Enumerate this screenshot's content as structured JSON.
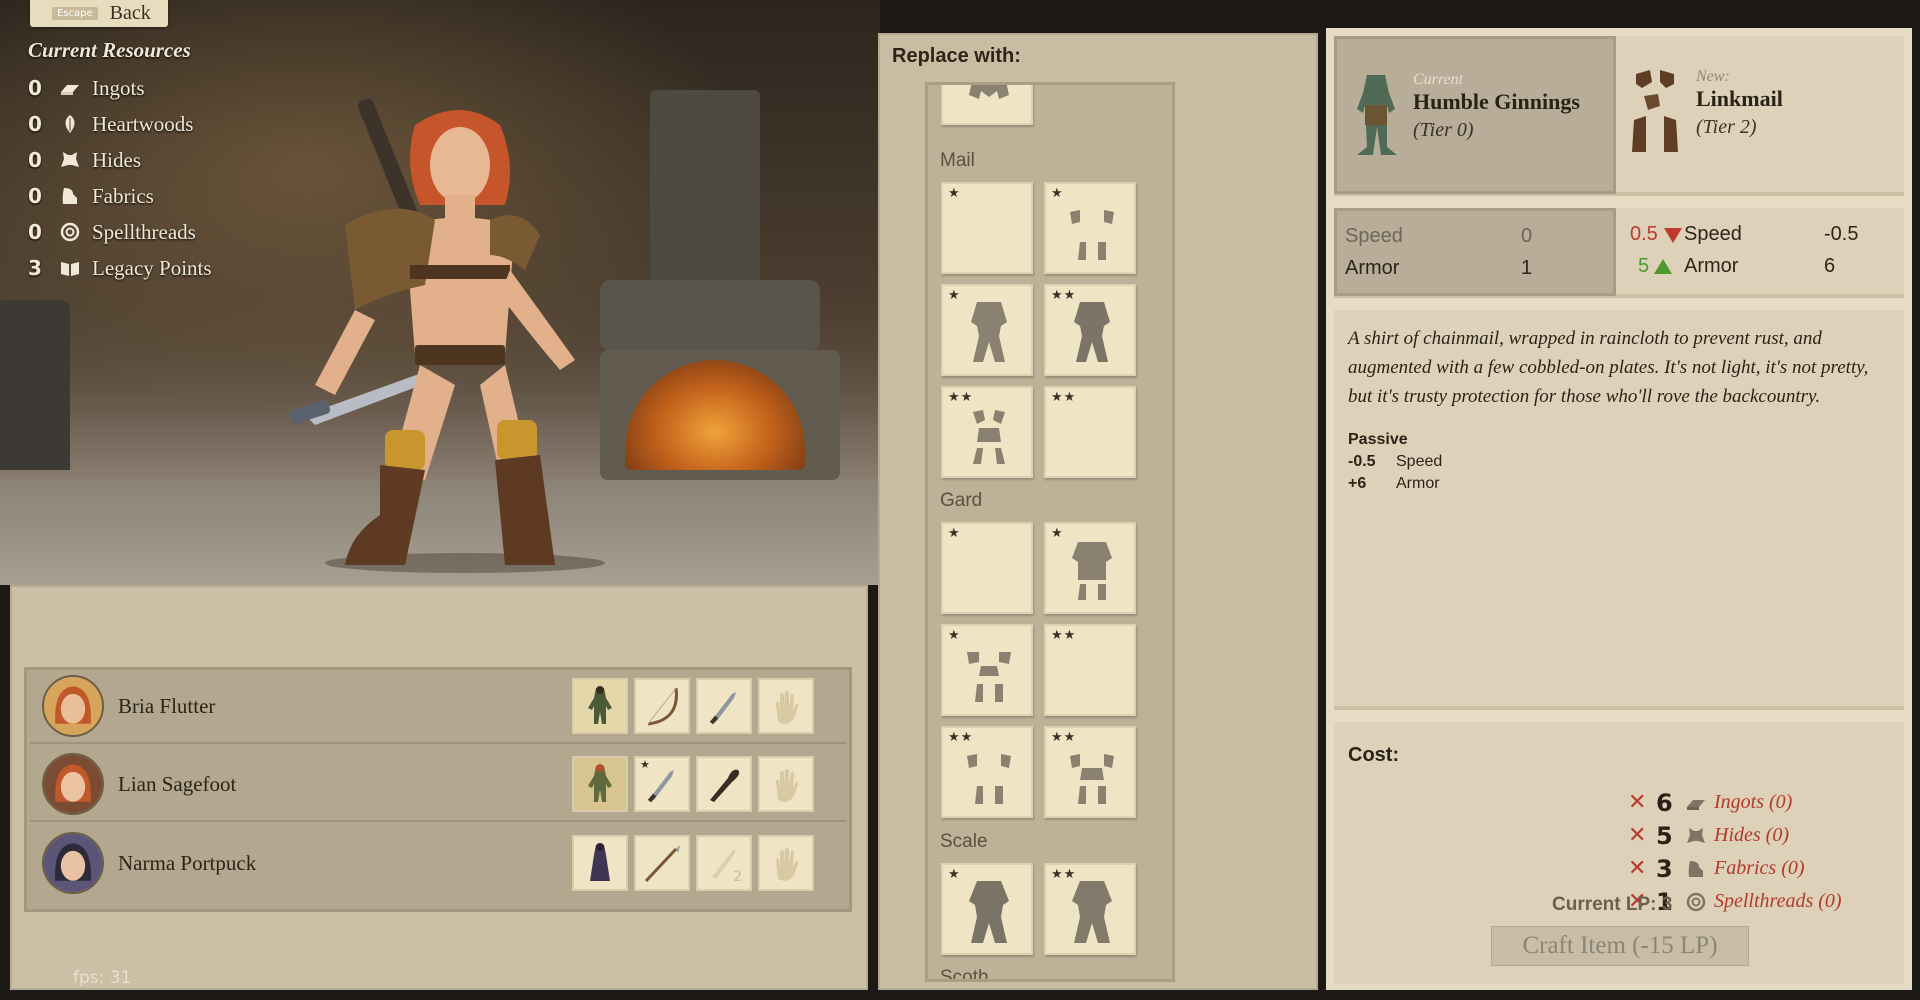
{
  "back": {
    "key": "Escape",
    "label": "Back"
  },
  "resources": {
    "title": "Current Resources",
    "items": [
      {
        "count": "0",
        "label": "Ingots",
        "icon": "ingot-icon"
      },
      {
        "count": "0",
        "label": "Heartwoods",
        "icon": "heartwood-icon"
      },
      {
        "count": "0",
        "label": "Hides",
        "icon": "hide-icon"
      },
      {
        "count": "0",
        "label": "Fabrics",
        "icon": "fabric-icon"
      },
      {
        "count": "0",
        "label": "Spellthreads",
        "icon": "spellthread-icon"
      },
      {
        "count": "3",
        "label": "Legacy Points",
        "icon": "book-icon"
      }
    ]
  },
  "party": [
    {
      "name": "Bria Flutter"
    },
    {
      "name": "Lian Sagefoot"
    },
    {
      "name": "Narma Portpuck"
    }
  ],
  "slot_badge": "2",
  "fps": "fps: 31",
  "replace": {
    "title": "Replace with:",
    "categories": [
      "Mail",
      "Gard",
      "Scale",
      "Scoth"
    ],
    "stars": {
      "one": "★",
      "two": "★★"
    }
  },
  "compare": {
    "current_label": "Current",
    "current_name": "Humble Ginnings",
    "current_tier": "(Tier 0)",
    "new_label": "New:",
    "new_name": "Linkmail",
    "new_tier": "(Tier 2)"
  },
  "stats": {
    "current": [
      {
        "label": "Speed",
        "value": "0"
      },
      {
        "label": "Armor",
        "value": "1"
      }
    ],
    "new": [
      {
        "delta": "0.5",
        "label": "Speed",
        "value": "-0.5"
      },
      {
        "delta": "5",
        "label": "Armor",
        "value": "6"
      }
    ]
  },
  "description": "A shirt of chainmail, wrapped in raincloth to prevent rust, and augmented with a few cobbled-on plates. It's not light, it's not pretty, but it's trusty protection for those who'll rove the backcountry.",
  "passive": {
    "title": "Passive",
    "rows": [
      {
        "value": "-0.5",
        "label": "Speed"
      },
      {
        "value": "+6",
        "label": "Armor"
      }
    ]
  },
  "cost": {
    "title": "Cost:",
    "items": [
      {
        "qty": "6",
        "label": "Ingots (0)"
      },
      {
        "qty": "5",
        "label": "Hides (0)"
      },
      {
        "qty": "3",
        "label": "Fabrics (0)"
      },
      {
        "qty": "1",
        "label": "Spellthreads (0)"
      }
    ],
    "current_lp": "Current LP: 3",
    "craft_label": "Craft Item (-15 LP)"
  },
  "colors": {
    "decrease": "#c0392b",
    "increase": "#4f9a2f",
    "cost_missing": "#b3392a"
  }
}
